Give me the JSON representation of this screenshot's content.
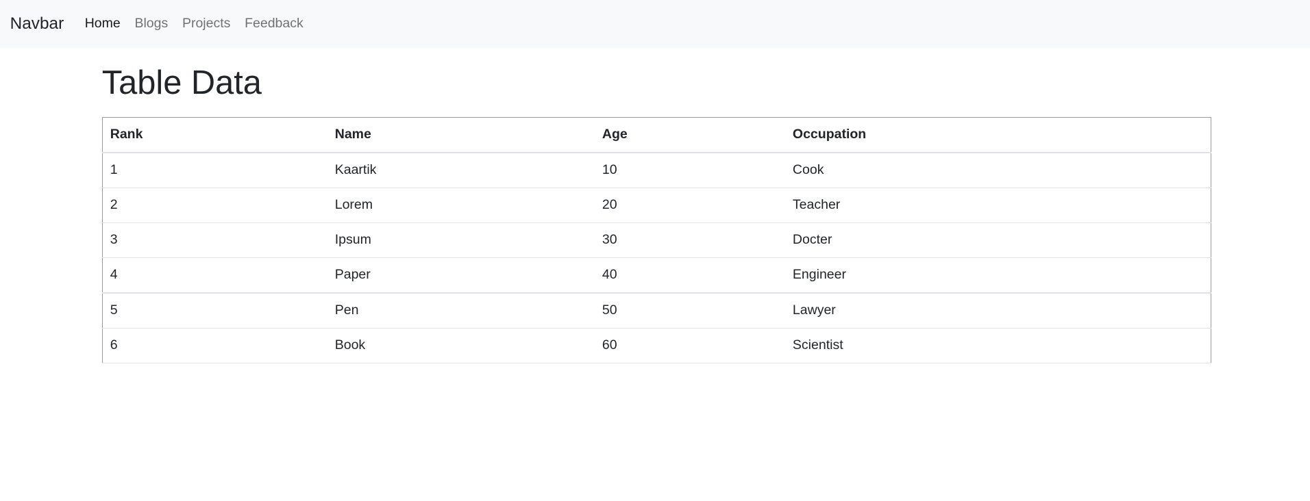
{
  "navbar": {
    "brand": "Navbar",
    "links": [
      {
        "label": "Home",
        "active": true
      },
      {
        "label": "Blogs",
        "active": false
      },
      {
        "label": "Projects",
        "active": false
      },
      {
        "label": "Feedback",
        "active": false
      }
    ]
  },
  "main": {
    "title": "Table Data",
    "table": {
      "headers": [
        "Rank",
        "Name",
        "Age",
        "Occupation"
      ],
      "rows": [
        [
          "1",
          "Kaartik",
          "10",
          "Cook"
        ],
        [
          "2",
          "Lorem",
          "20",
          "Teacher"
        ],
        [
          "3",
          "Ipsum",
          "30",
          "Docter"
        ],
        [
          "4",
          "Paper",
          "40",
          "Engineer"
        ],
        [
          "5",
          "Pen",
          "50",
          "Lawyer"
        ],
        [
          "6",
          "Book",
          "60",
          "Scientist"
        ]
      ]
    }
  }
}
